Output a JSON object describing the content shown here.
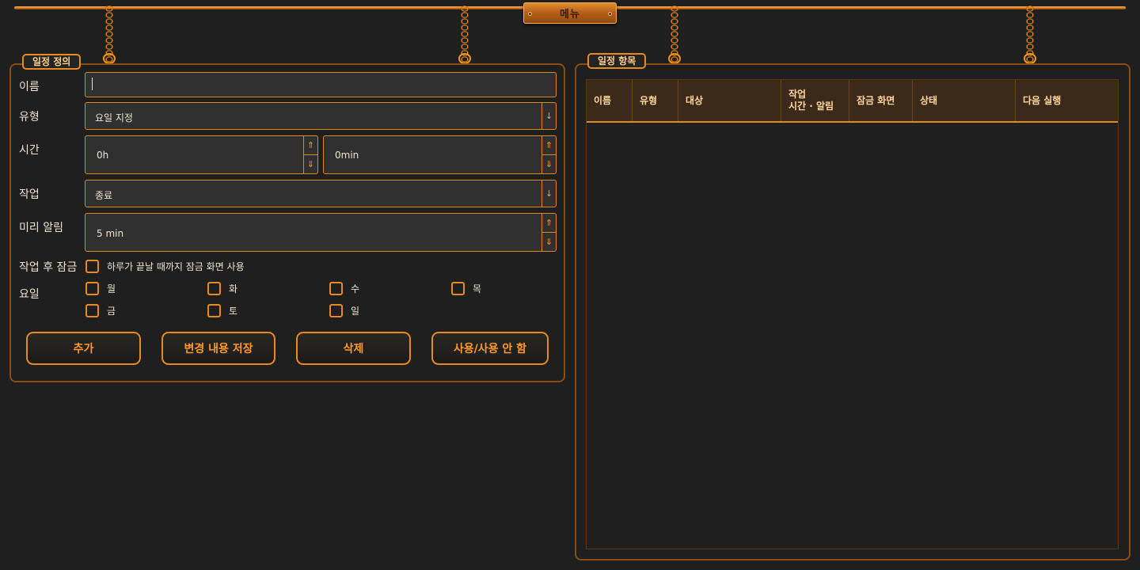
{
  "menu": {
    "label": "메뉴"
  },
  "left_panel": {
    "title": "일정 정의",
    "fields": {
      "name_label": "이름",
      "name_value": "",
      "type_label": "유형",
      "type_value": "요일 지정",
      "time_label": "시간",
      "hours_value": "0h",
      "minutes_value": "0min",
      "action_label": "작업",
      "action_value": "종료",
      "reminder_label": "미리 알림",
      "reminder_value": "5 min",
      "lock_label": "작업 후 잠금",
      "lock_checkbox_label": "하루가 끝날 때까지 잠금 화면 사용",
      "days_label": "요일"
    },
    "days": [
      "월",
      "화",
      "수",
      "목",
      "금",
      "토",
      "일"
    ],
    "buttons": {
      "add": "추가",
      "save": "변경 내용 저장",
      "delete": "삭제",
      "toggle": "사용/사용 안 함"
    }
  },
  "right_panel": {
    "title": "일정 항목",
    "columns": [
      "이름",
      "유형",
      "대상",
      "작업\n시간 · 알림",
      "잠금 화면",
      "상태",
      "다음 실행"
    ],
    "rows": []
  },
  "icons": {
    "dropdown": "↓",
    "spin_up": "⇑",
    "spin_down": "⇓"
  },
  "colors": {
    "background": "#1f1f1f",
    "accent": "#e88a1d",
    "button_text": "#ff9a2a",
    "header_bg": "#3b2a19"
  }
}
